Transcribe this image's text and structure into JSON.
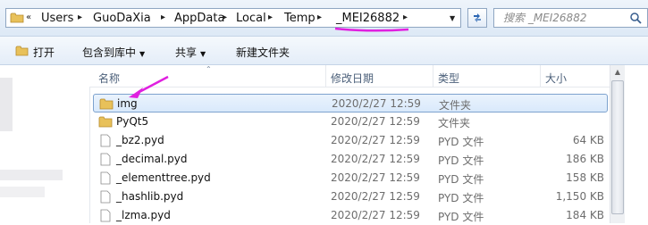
{
  "address_bar": {
    "overflow_label": "«",
    "crumbs": [
      "Users",
      "GuoDaXia",
      "AppData",
      "Local",
      "Temp",
      "_MEI26882"
    ],
    "separator": "▸",
    "dropdown": "▼",
    "refresh_icon": "refresh-icon"
  },
  "search": {
    "placeholder": "搜索 _MEI26882",
    "icon": "search-icon"
  },
  "annotation": {
    "underline_color": "#e020e0",
    "arrow_color": "#e020e0"
  },
  "toolbar": {
    "open_label": "打开",
    "include_label": "包含到库中",
    "share_label": "共享",
    "new_folder_label": "新建文件夹",
    "dropdown_arrow": "▼"
  },
  "columns": {
    "name": "名称",
    "date": "修改日期",
    "type": "类型",
    "size": "大小"
  },
  "files": [
    {
      "name": "img",
      "date": "2020/2/27 12:59",
      "type": "文件夹",
      "size": "",
      "icon": "folder-icon",
      "selected": true
    },
    {
      "name": "PyQt5",
      "date": "2020/2/27 12:59",
      "type": "文件夹",
      "size": "",
      "icon": "folder-icon",
      "selected": false
    },
    {
      "name": "_bz2.pyd",
      "date": "2020/2/27 12:59",
      "type": "PYD 文件",
      "size": "64 KB",
      "icon": "file-icon",
      "selected": false
    },
    {
      "name": "_decimal.pyd",
      "date": "2020/2/27 12:59",
      "type": "PYD 文件",
      "size": "186 KB",
      "icon": "file-icon",
      "selected": false
    },
    {
      "name": "_elementtree.pyd",
      "date": "2020/2/27 12:59",
      "type": "PYD 文件",
      "size": "158 KB",
      "icon": "file-icon",
      "selected": false
    },
    {
      "name": "_hashlib.pyd",
      "date": "2020/2/27 12:59",
      "type": "PYD 文件",
      "size": "1,150 KB",
      "icon": "file-icon",
      "selected": false
    },
    {
      "name": "_lzma.pyd",
      "date": "2020/2/27 12:59",
      "type": "PYD 文件",
      "size": "184 KB",
      "icon": "file-icon",
      "selected": false
    }
  ]
}
